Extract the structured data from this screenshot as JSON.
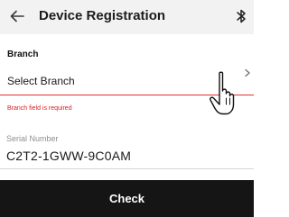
{
  "header": {
    "title": "Device Registration",
    "back_icon": "arrow-left-icon",
    "status_icon": "bluetooth-icon"
  },
  "branch": {
    "label": "Branch",
    "placeholder": "Select Branch",
    "chevron_icon": "chevron-right-icon",
    "error": "Branch field is required",
    "error_color": "#e4322e"
  },
  "serial": {
    "label": "Serial Number",
    "value": "C2T2-1GWW-9C0AM"
  },
  "actions": {
    "check_label": "Check"
  },
  "cursor": {
    "icon": "hand-pointer-icon"
  },
  "colors": {
    "topbar": "#f2f2f2",
    "button": "#151515",
    "button_text": "#ffffff",
    "error": "#d81b22"
  }
}
